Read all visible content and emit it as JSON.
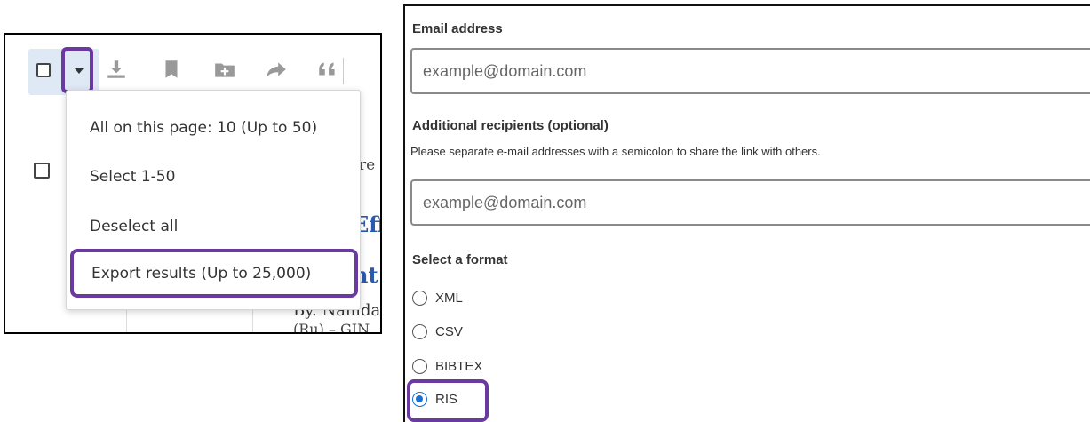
{
  "toolbar": {
    "icons": [
      "checkbox",
      "chevron-down-icon",
      "download-icon",
      "bookmark-icon",
      "folder-plus-icon",
      "share-icon",
      "quote-icon"
    ]
  },
  "dropdown": {
    "items": [
      {
        "label": "All on this page: 10 (Up to 50)"
      },
      {
        "label": "Select 1-50"
      },
      {
        "label": "Deselect all"
      },
      {
        "label": "Export results (Up to 25,000)"
      }
    ]
  },
  "background_text": {
    "fragment1": "re",
    "fragment2": "Eff",
    "fragment3": "nt",
    "fragment4": "By. Namda",
    "fragment5": "(Ru) – GIN"
  },
  "form": {
    "email_label": "Email address",
    "email_placeholder": "example@domain.com",
    "recipients_label": "Additional recipients (optional)",
    "recipients_hint": "Please separate e-mail addresses with a semicolon to share the link with others.",
    "recipients_placeholder": "example@domain.com",
    "format_label": "Select a format",
    "formats": [
      {
        "label": "XML",
        "checked": false
      },
      {
        "label": "CSV",
        "checked": false
      },
      {
        "label": "BIBTEX",
        "checked": false
      },
      {
        "label": "RIS",
        "checked": true
      }
    ]
  },
  "colors": {
    "highlight": "#6a3aa1",
    "radio_selected": "#1a6fd1",
    "toolbar_bg": "#dfe8f5",
    "link": "#2a5bb0"
  }
}
